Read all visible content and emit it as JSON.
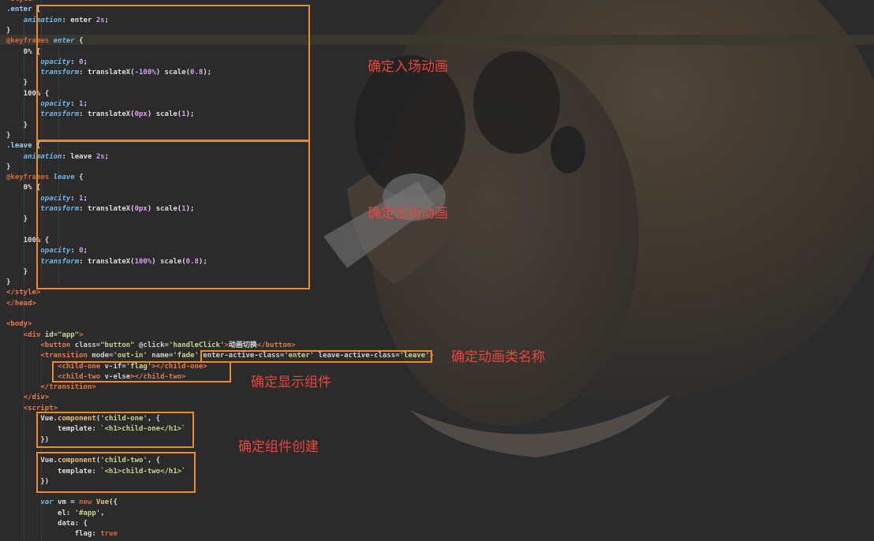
{
  "code_lines": [
    [
      [
        "tok-tag",
        "<style>"
      ]
    ],
    [
      [
        "tok-sel",
        ".enter"
      ],
      [
        "tok-plain",
        " {"
      ]
    ],
    [
      [
        "tok-plain",
        "    "
      ],
      [
        "tok-prop",
        "animation"
      ],
      [
        "tok-plain",
        ": enter "
      ],
      [
        "tok-num",
        "2s"
      ],
      [
        "tok-plain",
        ";"
      ]
    ],
    [
      [
        "tok-plain",
        "}"
      ]
    ],
    [
      [
        "tok-kw",
        "@keyframes "
      ],
      [
        "tok-prop",
        "enter"
      ],
      [
        "tok-plain",
        " {"
      ]
    ],
    [
      [
        "tok-plain",
        "    0% {"
      ]
    ],
    [
      [
        "tok-plain",
        "        "
      ],
      [
        "tok-prop",
        "opacity"
      ],
      [
        "tok-plain",
        ": "
      ],
      [
        "tok-num",
        "0"
      ],
      [
        "tok-plain",
        ";"
      ]
    ],
    [
      [
        "tok-plain",
        "        "
      ],
      [
        "tok-prop",
        "transform"
      ],
      [
        "tok-plain",
        ": translateX("
      ],
      [
        "tok-num",
        "-100%"
      ],
      [
        "tok-plain",
        ") scale("
      ],
      [
        "tok-num",
        "0.8"
      ],
      [
        "tok-plain",
        ");"
      ]
    ],
    [
      [
        "tok-plain",
        "    }"
      ]
    ],
    [
      [
        "tok-plain",
        "    100% {"
      ]
    ],
    [
      [
        "tok-plain",
        "        "
      ],
      [
        "tok-prop",
        "opacity"
      ],
      [
        "tok-plain",
        ": "
      ],
      [
        "tok-num",
        "1"
      ],
      [
        "tok-plain",
        ";"
      ]
    ],
    [
      [
        "tok-plain",
        "        "
      ],
      [
        "tok-prop",
        "transform"
      ],
      [
        "tok-plain",
        ": translateX("
      ],
      [
        "tok-num",
        "0px"
      ],
      [
        "tok-plain",
        ") scale("
      ],
      [
        "tok-num",
        "1"
      ],
      [
        "tok-plain",
        ");"
      ]
    ],
    [
      [
        "tok-plain",
        "    }"
      ]
    ],
    [
      [
        "tok-plain",
        "}"
      ]
    ],
    [
      [
        "tok-sel",
        ".leave"
      ],
      [
        "tok-plain",
        " {"
      ]
    ],
    [
      [
        "tok-plain",
        "    "
      ],
      [
        "tok-prop",
        "animation"
      ],
      [
        "tok-plain",
        ": leave "
      ],
      [
        "tok-num",
        "2s"
      ],
      [
        "tok-plain",
        ";"
      ]
    ],
    [
      [
        "tok-plain",
        "}"
      ]
    ],
    [
      [
        "tok-kw",
        "@keyframes "
      ],
      [
        "tok-prop",
        "leave"
      ],
      [
        "tok-plain",
        " {"
      ]
    ],
    [
      [
        "tok-plain",
        "    0% {"
      ]
    ],
    [
      [
        "tok-plain",
        "        "
      ],
      [
        "tok-prop",
        "opacity"
      ],
      [
        "tok-plain",
        ": "
      ],
      [
        "tok-num",
        "1"
      ],
      [
        "tok-plain",
        ";"
      ]
    ],
    [
      [
        "tok-plain",
        "        "
      ],
      [
        "tok-prop",
        "transform"
      ],
      [
        "tok-plain",
        ": translateX("
      ],
      [
        "tok-num",
        "0px"
      ],
      [
        "tok-plain",
        ") scale("
      ],
      [
        "tok-num",
        "1"
      ],
      [
        "tok-plain",
        ");"
      ]
    ],
    [
      [
        "tok-plain",
        "    }"
      ]
    ],
    [],
    [
      [
        "tok-plain",
        "    100% {"
      ]
    ],
    [
      [
        "tok-plain",
        "        "
      ],
      [
        "tok-prop",
        "opacity"
      ],
      [
        "tok-plain",
        ": "
      ],
      [
        "tok-num",
        "0"
      ],
      [
        "tok-plain",
        ";"
      ]
    ],
    [
      [
        "tok-plain",
        "        "
      ],
      [
        "tok-prop",
        "transform"
      ],
      [
        "tok-plain",
        ": translateX("
      ],
      [
        "tok-num",
        "100%"
      ],
      [
        "tok-plain",
        ") scale("
      ],
      [
        "tok-num",
        "0.8"
      ],
      [
        "tok-plain",
        ");"
      ]
    ],
    [
      [
        "tok-plain",
        "    }"
      ]
    ],
    [
      [
        "tok-plain",
        "}"
      ]
    ],
    [
      [
        "tok-tag",
        "</style>"
      ]
    ],
    [
      [
        "tok-tag",
        "</head>"
      ]
    ],
    [],
    [
      [
        "tok-tag",
        "<body>"
      ]
    ],
    [
      [
        "tok-plain",
        "    "
      ],
      [
        "tok-tag",
        "<div "
      ],
      [
        "tok-attr",
        "id="
      ],
      [
        "tok-str",
        "\"app\""
      ],
      [
        "tok-tag",
        ">"
      ]
    ],
    [
      [
        "tok-plain",
        "        "
      ],
      [
        "tok-tag",
        "<button "
      ],
      [
        "tok-attr",
        "class="
      ],
      [
        "tok-str",
        "\"button\" "
      ],
      [
        "tok-attr",
        "@click="
      ],
      [
        "tok-str",
        "'handleClick'"
      ],
      [
        "tok-tag",
        ">"
      ],
      [
        "tok-plain",
        "动画切换"
      ],
      [
        "tok-tag",
        "</button>"
      ]
    ],
    [
      [
        "tok-plain",
        "        "
      ],
      [
        "tok-tag",
        "<transition "
      ],
      [
        "tok-attr",
        "mode="
      ],
      [
        "tok-str",
        "'out-in' "
      ],
      [
        "tok-attr",
        "name="
      ],
      [
        "tok-str",
        "'fade' "
      ],
      [
        "tok-attr",
        "enter-active-class="
      ],
      [
        "tok-str",
        "'enter' "
      ],
      [
        "tok-attr",
        "leave-active-class="
      ],
      [
        "tok-str",
        "'leave'"
      ],
      [
        "tok-tag",
        ">"
      ]
    ],
    [
      [
        "tok-plain",
        "            "
      ],
      [
        "tok-tag",
        "<child-one "
      ],
      [
        "tok-attr",
        "v-if="
      ],
      [
        "tok-str",
        "'flag'"
      ],
      [
        "tok-tag",
        "></child-one>"
      ]
    ],
    [
      [
        "tok-plain",
        "            "
      ],
      [
        "tok-tag",
        "<child-two "
      ],
      [
        "tok-attr",
        "v-else"
      ],
      [
        "tok-tag",
        "></child-two>"
      ]
    ],
    [
      [
        "tok-plain",
        "        "
      ],
      [
        "tok-tag",
        "</transition>"
      ]
    ],
    [
      [
        "tok-plain",
        "    "
      ],
      [
        "tok-tag",
        "</div>"
      ]
    ],
    [
      [
        "tok-plain",
        "    "
      ],
      [
        "tok-tag",
        "<script>"
      ]
    ],
    [
      [
        "tok-plain",
        "        Vue."
      ],
      [
        "tok-fn",
        "component"
      ],
      [
        "tok-plain",
        "("
      ],
      [
        "tok-str",
        "'child-one'"
      ],
      [
        "tok-plain",
        ", {"
      ]
    ],
    [
      [
        "tok-plain",
        "            template: "
      ],
      [
        "tok-str",
        "`<h1>child-one</h1>`"
      ]
    ],
    [
      [
        "tok-plain",
        "        })"
      ]
    ],
    [],
    [
      [
        "tok-plain",
        "        Vue."
      ],
      [
        "tok-fn",
        "component"
      ],
      [
        "tok-plain",
        "("
      ],
      [
        "tok-str",
        "'child-two'"
      ],
      [
        "tok-plain",
        ", {"
      ]
    ],
    [
      [
        "tok-plain",
        "            template: "
      ],
      [
        "tok-str",
        "`<h1>child-two</h1>`"
      ]
    ],
    [
      [
        "tok-plain",
        "        })"
      ]
    ],
    [],
    [
      [
        "tok-plain",
        "        "
      ],
      [
        "tok-var",
        "var"
      ],
      [
        "tok-plain",
        " vm = "
      ],
      [
        "tok-new",
        "new "
      ],
      [
        "tok-fn",
        "Vue"
      ],
      [
        "tok-plain",
        "({"
      ]
    ],
    [
      [
        "tok-plain",
        "            el: "
      ],
      [
        "tok-str",
        "'#app'"
      ],
      [
        "tok-plain",
        ","
      ]
    ],
    [
      [
        "tok-plain",
        "            data: {"
      ]
    ],
    [
      [
        "tok-plain",
        "                flag: "
      ],
      [
        "tok-new",
        "true"
      ]
    ]
  ],
  "annotations": {
    "enter_animation": "确定入场动画",
    "leave_animation": "确定出场动画",
    "animation_class_names": "确定动画类名称",
    "display_components": "确定显示组件",
    "component_creation": "确定组件创建"
  }
}
